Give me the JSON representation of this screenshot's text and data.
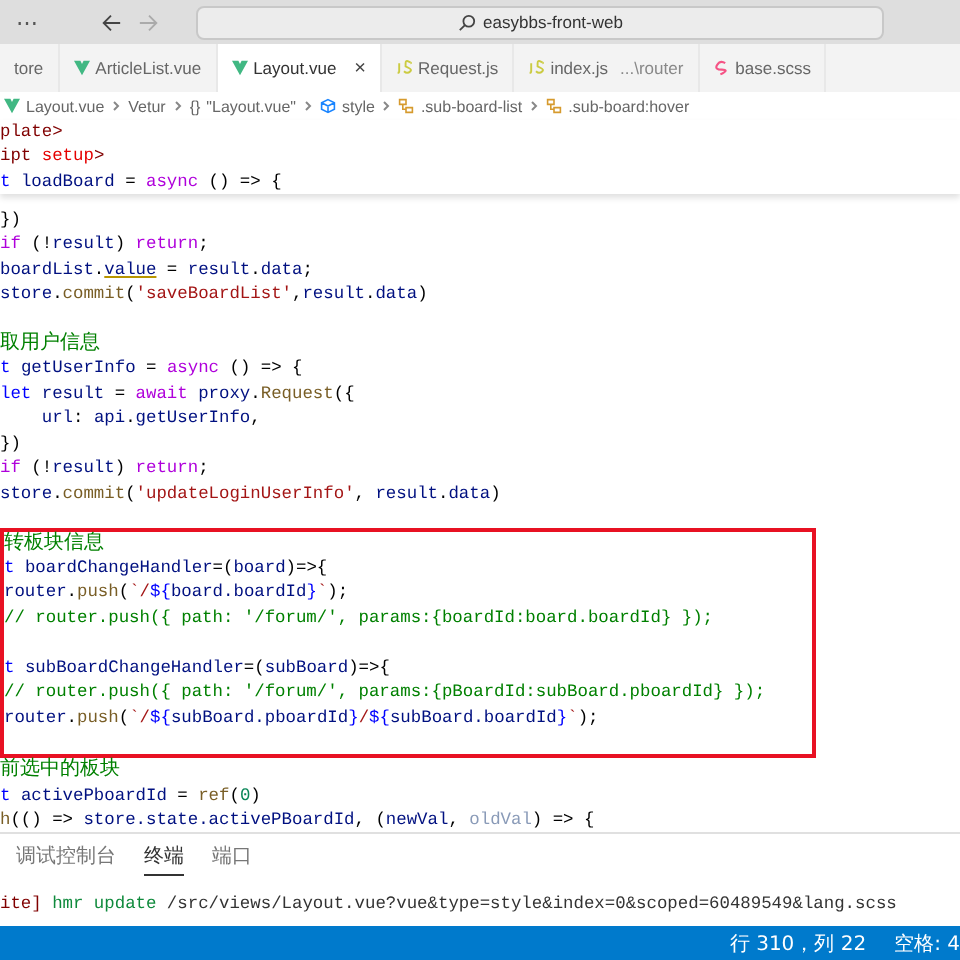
{
  "title_bar": {
    "more": "⋯",
    "search": "easybbs-front-web"
  },
  "tabs": [
    {
      "label": "tore",
      "kind": "plain",
      "selected": false
    },
    {
      "label": "ArticleList.vue",
      "kind": "vue",
      "selected": false
    },
    {
      "label": "Layout.vue",
      "kind": "vue",
      "selected": true,
      "close": "×"
    },
    {
      "label": "Request.js",
      "kind": "js",
      "selected": false
    },
    {
      "label": "index.js",
      "detail": "...\\router",
      "kind": "js",
      "selected": false
    },
    {
      "label": "base.scss",
      "kind": "scss",
      "selected": false
    }
  ],
  "breadcrumb": [
    {
      "text": "Layout.vue",
      "kind": "vue"
    },
    {
      "text": "Vetur",
      "kind": "plain"
    },
    {
      "glyph": "{}",
      "text": "\"Layout.vue\"",
      "kind": "plain"
    },
    {
      "text": "style",
      "kind": "style"
    },
    {
      "text": ".sub-board-list",
      "kind": "selector"
    },
    {
      "text": ".sub-board:hover",
      "kind": "selector"
    }
  ],
  "sticky_lines": [
    [
      {
        "kind": "tag",
        "text": "plate>"
      }
    ],
    [
      {
        "kind": "tag",
        "text": "ipt "
      },
      {
        "kind": "attr",
        "text": "setup"
      },
      {
        "kind": "tag",
        "text": ">"
      }
    ],
    [
      {
        "kind": "kw",
        "text": "t "
      },
      {
        "kind": "var",
        "text": "loadBoard"
      },
      {
        "kind": "punc",
        "text": " = "
      },
      {
        "kind": "ctrl",
        "text": "async"
      },
      {
        "kind": "punc",
        "text": " () => {"
      }
    ]
  ],
  "code": [
    {
      "boxed": false,
      "lines": [
        {
          "kind": "code",
          "tokens": [
            {
              "kind": "punc",
              "text": "})"
            }
          ]
        },
        {
          "kind": "code",
          "tokens": [
            {
              "kind": "ctrl",
              "text": "if"
            },
            {
              "kind": "punc",
              "text": " (!"
            },
            {
              "kind": "var",
              "text": "result"
            },
            {
              "kind": "punc",
              "text": ") "
            },
            {
              "kind": "ctrl",
              "text": "return"
            },
            {
              "kind": "punc",
              "text": ";"
            }
          ]
        },
        {
          "kind": "code",
          "tokens": [
            {
              "kind": "var",
              "text": "boardList"
            },
            {
              "kind": "punc",
              "text": "."
            },
            {
              "kind": "warn",
              "text": "value"
            },
            {
              "kind": "punc",
              "text": " = "
            },
            {
              "kind": "var",
              "text": "result"
            },
            {
              "kind": "punc",
              "text": "."
            },
            {
              "kind": "var",
              "text": "data"
            },
            {
              "kind": "punc",
              "text": ";"
            }
          ]
        },
        {
          "kind": "code",
          "tokens": [
            {
              "kind": "var",
              "text": "store"
            },
            {
              "kind": "punc",
              "text": "."
            },
            {
              "kind": "fn",
              "text": "commit"
            },
            {
              "kind": "punc",
              "text": "("
            },
            {
              "kind": "str",
              "text": "'saveBoardList'"
            },
            {
              "kind": "punc",
              "text": ","
            },
            {
              "kind": "var",
              "text": "result"
            },
            {
              "kind": "punc",
              "text": "."
            },
            {
              "kind": "var",
              "text": "data"
            },
            {
              "kind": "punc",
              "text": ")"
            }
          ]
        },
        {
          "kind": "blank"
        },
        {
          "kind": "code",
          "tokens": [
            {
              "kind": "cmt",
              "text": "取用户信息"
            }
          ]
        },
        {
          "kind": "code",
          "tokens": [
            {
              "kind": "kw",
              "text": "t "
            },
            {
              "kind": "var",
              "text": "getUserInfo"
            },
            {
              "kind": "punc",
              "text": " = "
            },
            {
              "kind": "ctrl",
              "text": "async"
            },
            {
              "kind": "punc",
              "text": " () => {"
            }
          ]
        },
        {
          "kind": "code",
          "tokens": [
            {
              "kind": "kw",
              "text": "let "
            },
            {
              "kind": "var",
              "text": "result"
            },
            {
              "kind": "punc",
              "text": " = "
            },
            {
              "kind": "ctrl",
              "text": "await "
            },
            {
              "kind": "var",
              "text": "proxy"
            },
            {
              "kind": "punc",
              "text": "."
            },
            {
              "kind": "fn",
              "text": "Request"
            },
            {
              "kind": "punc",
              "text": "({"
            }
          ]
        },
        {
          "kind": "code",
          "tokens": [
            {
              "kind": "var",
              "text": "    url"
            },
            {
              "kind": "punc",
              "text": ": "
            },
            {
              "kind": "var",
              "text": "api"
            },
            {
              "kind": "punc",
              "text": "."
            },
            {
              "kind": "var",
              "text": "getUserInfo"
            },
            {
              "kind": "punc",
              "text": ","
            }
          ]
        },
        {
          "kind": "code",
          "tokens": [
            {
              "kind": "punc",
              "text": "})"
            }
          ]
        },
        {
          "kind": "code",
          "tokens": [
            {
              "kind": "ctrl",
              "text": "if"
            },
            {
              "kind": "punc",
              "text": " (!"
            },
            {
              "kind": "var",
              "text": "result"
            },
            {
              "kind": "punc",
              "text": ") "
            },
            {
              "kind": "ctrl",
              "text": "return"
            },
            {
              "kind": "punc",
              "text": ";"
            }
          ]
        },
        {
          "kind": "code",
          "tokens": [
            {
              "kind": "var",
              "text": "store"
            },
            {
              "kind": "punc",
              "text": "."
            },
            {
              "kind": "fn",
              "text": "commit"
            },
            {
              "kind": "punc",
              "text": "("
            },
            {
              "kind": "str",
              "text": "'updateLoginUserInfo'"
            },
            {
              "kind": "punc",
              "text": ", "
            },
            {
              "kind": "var",
              "text": "result"
            },
            {
              "kind": "punc",
              "text": "."
            },
            {
              "kind": "var",
              "text": "data"
            },
            {
              "kind": "punc",
              "text": ")"
            }
          ]
        },
        {
          "kind": "blank"
        }
      ]
    },
    {
      "boxed": true,
      "lines": [
        {
          "kind": "code",
          "tokens": [
            {
              "kind": "cmt",
              "text": "转板块信息"
            }
          ]
        },
        {
          "kind": "code",
          "tokens": [
            {
              "kind": "kw",
              "text": "t "
            },
            {
              "kind": "var",
              "text": "boardChangeHandler"
            },
            {
              "kind": "punc",
              "text": "=("
            },
            {
              "kind": "var",
              "text": "board"
            },
            {
              "kind": "punc",
              "text": ")=>{"
            }
          ]
        },
        {
          "kind": "code",
          "tokens": [
            {
              "kind": "var",
              "text": "router"
            },
            {
              "kind": "punc",
              "text": "."
            },
            {
              "kind": "fn",
              "text": "push"
            },
            {
              "kind": "punc",
              "text": "("
            },
            {
              "kind": "str",
              "text": "`/"
            },
            {
              "kind": "kw",
              "text": "${"
            },
            {
              "kind": "var",
              "text": "board.boardId"
            },
            {
              "kind": "kw",
              "text": "}"
            },
            {
              "kind": "str",
              "text": "`"
            },
            {
              "kind": "punc",
              "text": ");"
            }
          ]
        },
        {
          "kind": "code",
          "tokens": [
            {
              "kind": "cmt",
              "text": "// router.push({ path: '/forum/', params:{boardId:board.boardId} });"
            }
          ]
        },
        {
          "kind": "blank"
        },
        {
          "kind": "code",
          "tokens": [
            {
              "kind": "kw",
              "text": "t "
            },
            {
              "kind": "var",
              "text": "subBoardChangeHandler"
            },
            {
              "kind": "punc",
              "text": "=("
            },
            {
              "kind": "var",
              "text": "subBoard"
            },
            {
              "kind": "punc",
              "text": ")=>{"
            }
          ]
        },
        {
          "kind": "code",
          "tokens": [
            {
              "kind": "cmt",
              "text": "// router.push({ path: '/forum/', params:{pBoardId:subBoard.pboardId} });"
            }
          ]
        },
        {
          "kind": "code",
          "tokens": [
            {
              "kind": "var",
              "text": "router"
            },
            {
              "kind": "punc",
              "text": "."
            },
            {
              "kind": "fn",
              "text": "push"
            },
            {
              "kind": "punc",
              "text": "("
            },
            {
              "kind": "str",
              "text": "`/"
            },
            {
              "kind": "kw",
              "text": "${"
            },
            {
              "kind": "var",
              "text": "subBoard.pboardId"
            },
            {
              "kind": "kw",
              "text": "}"
            },
            {
              "kind": "str",
              "text": "/"
            },
            {
              "kind": "kw",
              "text": "${"
            },
            {
              "kind": "var",
              "text": "subBoard.boardId"
            },
            {
              "kind": "kw",
              "text": "}"
            },
            {
              "kind": "str",
              "text": "`"
            },
            {
              "kind": "punc",
              "text": ");"
            }
          ]
        },
        {
          "kind": "blank"
        }
      ]
    },
    {
      "boxed": false,
      "lines": [
        {
          "kind": "code",
          "tokens": [
            {
              "kind": "cmt",
              "text": "前选中的板块"
            }
          ]
        },
        {
          "kind": "code",
          "tokens": [
            {
              "kind": "kw",
              "text": "t "
            },
            {
              "kind": "var",
              "text": "activePboardId"
            },
            {
              "kind": "punc",
              "text": " = "
            },
            {
              "kind": "fn",
              "text": "ref"
            },
            {
              "kind": "punc",
              "text": "("
            },
            {
              "kind": "num",
              "text": "0"
            },
            {
              "kind": "punc",
              "text": ")"
            }
          ]
        },
        {
          "kind": "code",
          "tokens": [
            {
              "kind": "fn",
              "text": "h"
            },
            {
              "kind": "punc",
              "text": "(() => "
            },
            {
              "kind": "var",
              "text": "store.state.activePBoardId"
            },
            {
              "kind": "punc",
              "text": ", ("
            },
            {
              "kind": "var",
              "text": "newVal"
            },
            {
              "kind": "punc",
              "text": ", "
            },
            {
              "kind": "dim",
              "text": "oldVal"
            },
            {
              "kind": "punc",
              "text": ") => {"
            }
          ]
        }
      ]
    }
  ],
  "panel": {
    "tabs": [
      {
        "label": "调试控制台",
        "selected": false
      },
      {
        "label": "终端",
        "selected": true
      },
      {
        "label": "端口",
        "selected": false
      }
    ],
    "output": [
      {
        "kind": "tag",
        "text": "ite]"
      },
      {
        "kind": "ok",
        "text": " hmr update"
      },
      {
        "kind": "path",
        "text": " /src/views/Layout.vue?vue&type=style&index=0&scoped=60489549&lang.scss"
      }
    ]
  },
  "status_bar": {
    "items": [
      "行 310，列 22",
      "空格: 4"
    ]
  }
}
